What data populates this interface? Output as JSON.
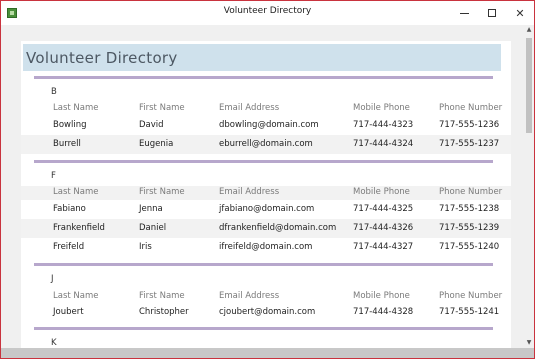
{
  "window": {
    "title": "Volunteer Directory"
  },
  "report": {
    "title": "Volunteer Directory",
    "columns": [
      "Last Name",
      "First Name",
      "Email Address",
      "Mobile Phone",
      "Phone Number"
    ],
    "groups": [
      {
        "letter": "B",
        "rows": [
          [
            "Bowling",
            "David",
            "dbowling@domain.com",
            "717-444-4323",
            "717-555-1236"
          ],
          [
            "Burrell",
            "Eugenia",
            "eburrell@domain.com",
            "717-444-4324",
            "717-555-1237"
          ]
        ]
      },
      {
        "letter": "F",
        "rows": [
          [
            "Fabiano",
            "Jenna",
            "jfabiano@domain.com",
            "717-444-4325",
            "717-555-1238"
          ],
          [
            "Frankenfield",
            "Daniel",
            "dfrankenfield@domain.com",
            "717-444-4326",
            "717-555-1239"
          ],
          [
            "Freifeld",
            "Iris",
            "ifreifeld@domain.com",
            "717-444-4327",
            "717-555-1240"
          ]
        ]
      },
      {
        "letter": "J",
        "rows": [
          [
            "Joubert",
            "Christopher",
            "cjoubert@domain.com",
            "717-444-4328",
            "717-555-1241"
          ]
        ]
      },
      {
        "letter": "K",
        "rows": []
      }
    ]
  }
}
